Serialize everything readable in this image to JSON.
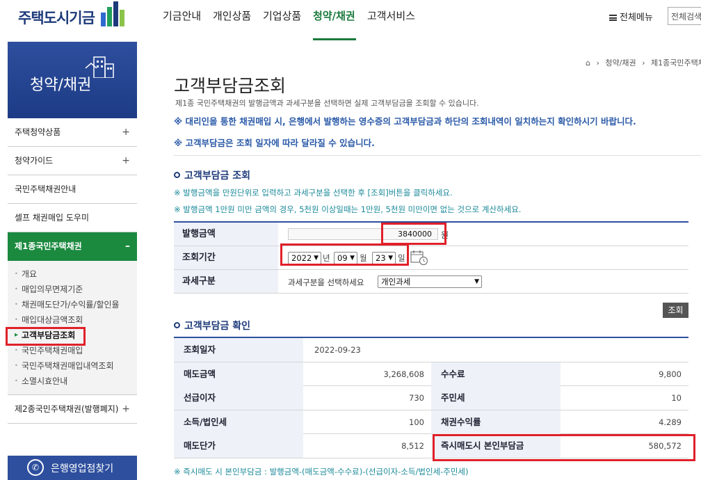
{
  "header": {
    "logo_text": "주택도시기금",
    "nav": [
      "기금안내",
      "개인상품",
      "기업상품",
      "청약/채권",
      "고객서비스"
    ],
    "active_nav": "청약/채권",
    "all_menu": "전체메뉴",
    "search_placeholder": "전체검색"
  },
  "sidebar": {
    "title": "청약/채권",
    "items": [
      {
        "label": "주택청약상품",
        "toggle": "+"
      },
      {
        "label": "청약가이드",
        "toggle": "+"
      },
      {
        "label": "국민주택채권안내",
        "toggle": ""
      },
      {
        "label": "셀프 채권매입 도우미",
        "toggle": ""
      },
      {
        "label": "제1종국민주택채권",
        "toggle": "–"
      }
    ],
    "sub_items": [
      "개요",
      "매입의무면제기준",
      "채권매도단가/수익률/할인율",
      "매입대상금액조회",
      "고객부담금조회",
      "국민주택채권매입",
      "국민주택채권매입내역조회",
      "소멸시효안내"
    ],
    "current_sub": "고객부담금조회",
    "item_after": {
      "label": "제2종국민주택채권(발행폐지)",
      "toggle": "+"
    },
    "branch_button": "은행영업점찾기"
  },
  "breadcrumb": [
    "청약/채권",
    "제1종국민주택채"
  ],
  "page": {
    "title": "고객부담금조회",
    "description": "제1종 국민주택채권의 발행금액과 과세구분을 선택하면 실제 고객부담금을 조회할 수 있습니다.",
    "note1": "※ 대리인을 통한 채권매입 시, 은행에서 발행하는 영수증의 고객부담금과 하단의 조회내역이 일치하는지 확인하시기 바랍니다.",
    "note2": "※ 고객부담금은 조회 일자에 따라 달라질 수 있습니다."
  },
  "query_section": {
    "title": "고객부담금 조회",
    "guide1": "※ 발행금액을 만원단위로 입력하고 과세구분을 선택한 후 [조회]버튼을 클릭하세요.",
    "guide2": "※ 발행금액 1만원 미만 금액의 경우, 5천원 이상일때는 1만원, 5천원 미만이면 없는 것으로 계산하세요.",
    "amount_label": "발행금액",
    "amount_value": "3840000",
    "amount_unit": "원",
    "period_label": "조회기간",
    "year": "2022",
    "year_unit": "년",
    "month": "09",
    "month_unit": "월",
    "day": "23",
    "day_unit": "일",
    "tax_label": "과세구분",
    "tax_prompt": "과세구분을 선택하세요",
    "tax_value": "개인과세",
    "query_button": "조회"
  },
  "result_section": {
    "title": "고객부담금 확인",
    "date_label": "조회일자",
    "date_value": "2022-09-23",
    "rows": [
      {
        "l1": "매도금액",
        "v1": "3,268,608",
        "l2": "수수료",
        "v2": "9,800"
      },
      {
        "l1": "선급이자",
        "v1": "730",
        "l2": "주민세",
        "v2": "10"
      },
      {
        "l1": "소득/법인세",
        "v1": "100",
        "l2": "채권수익률",
        "v2": "4.289"
      },
      {
        "l1": "매도단가",
        "v1": "8,512",
        "l2": "즉시매도시 본인부담금",
        "v2": "580,572"
      }
    ],
    "formula": "※ 즉시매도 시 본인부담금 : 발행금액-(매도금액-수수료)-(선급이자-소득/법인세-주민세)"
  },
  "colors": {
    "brand_blue": "#2e4f9e",
    "brand_green": "#1b8a3f",
    "highlight_red": "#e0202a"
  }
}
